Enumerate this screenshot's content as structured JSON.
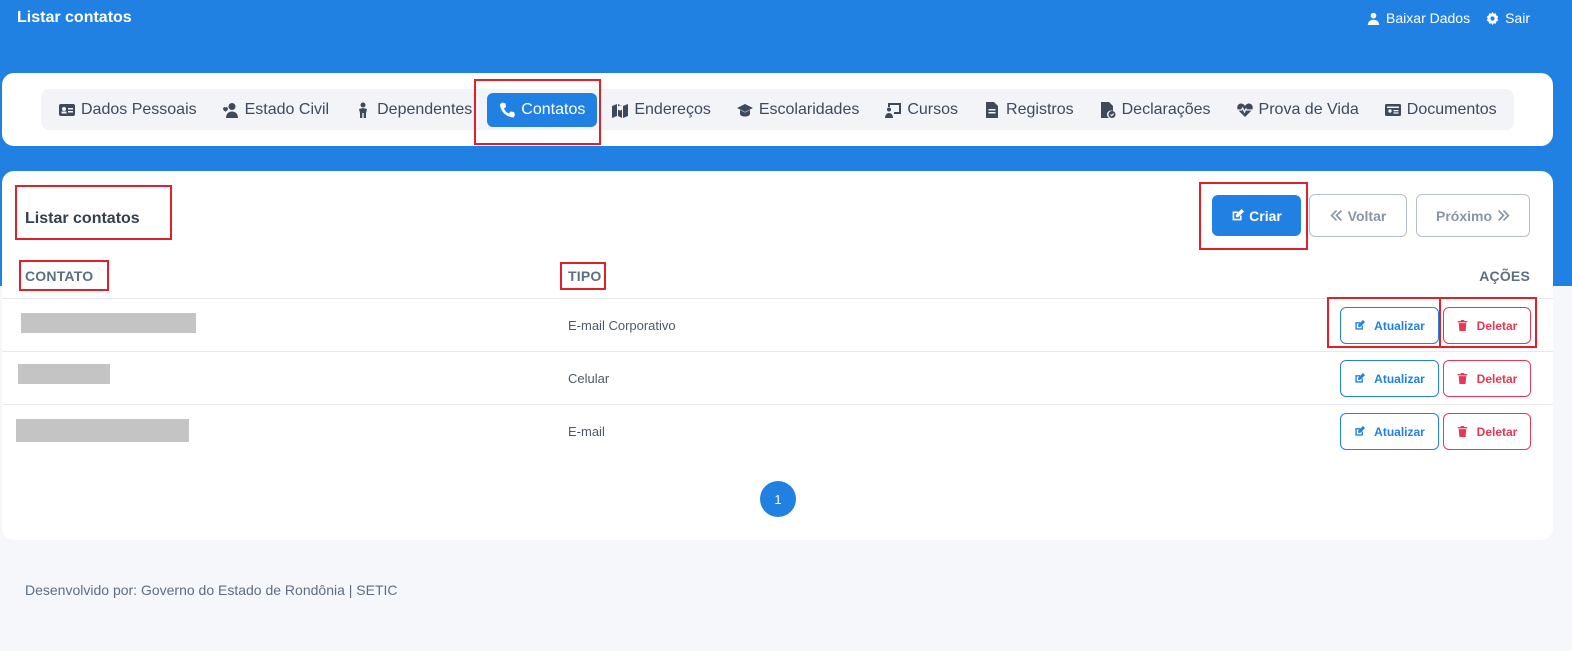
{
  "header": {
    "title": "Listar contatos",
    "actions": [
      {
        "label": "Baixar Dados",
        "icon": "user-icon"
      },
      {
        "label": "Sair",
        "icon": "gear-icon"
      }
    ]
  },
  "tabs": [
    {
      "label": "Dados Pessoais",
      "icon": "id-card-icon"
    },
    {
      "label": "Estado Civil",
      "icon": "user-heart-icon"
    },
    {
      "label": "Dependentes",
      "icon": "child-icon"
    },
    {
      "label": "Contatos",
      "icon": "phone-icon",
      "active": true
    },
    {
      "label": "Endereços",
      "icon": "map-icon"
    },
    {
      "label": "Escolaridades",
      "icon": "graduation-cap-icon"
    },
    {
      "label": "Cursos",
      "icon": "chalkboard-icon"
    },
    {
      "label": "Registros",
      "icon": "file-icon"
    },
    {
      "label": "Declarações",
      "icon": "file-check-icon"
    },
    {
      "label": "Prova de Vida",
      "icon": "heartbeat-icon"
    },
    {
      "label": "Documentos",
      "icon": "id-badge-icon"
    }
  ],
  "main": {
    "title": "Listar contatos",
    "buttons": {
      "create": "Criar",
      "back": "Voltar",
      "next": "Próximo"
    },
    "columns": {
      "contact": "CONTATO",
      "type": "TIPO",
      "actions": "AÇÕES"
    },
    "rows": [
      {
        "tipo": "E-mail Corporativo",
        "update": "Atualizar",
        "delete": "Deletar"
      },
      {
        "tipo": "Celular",
        "update": "Atualizar",
        "delete": "Deletar"
      },
      {
        "tipo": "E-mail",
        "update": "Atualizar",
        "delete": "Deletar"
      }
    ],
    "pagination": {
      "current": "1"
    }
  },
  "footer": {
    "text": "Desenvolvido por: Governo do Estado de Rondônia | SETIC"
  },
  "colors": {
    "primary": "#2181e2",
    "danger": "#e63757",
    "highlight": "#e0202a"
  }
}
